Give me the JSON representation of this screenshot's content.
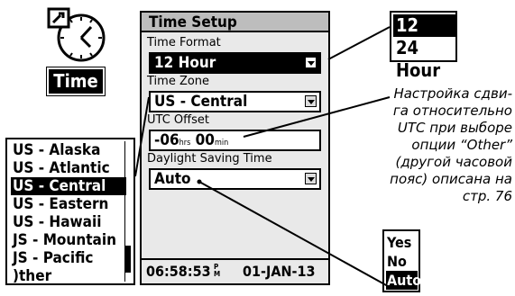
{
  "app": {
    "label": "Time",
    "icon": "clock-with-wrench-icon"
  },
  "screen": {
    "title": "Time Setup",
    "time_format": {
      "label": "Time Format",
      "value": "12 Hour"
    },
    "time_zone": {
      "label": "Time Zone",
      "value": "US - Central"
    },
    "utc_offset": {
      "label": "UTC Offset",
      "hours": "-06",
      "hours_unit": "hrs",
      "minutes": "00",
      "minutes_unit": "min"
    },
    "dst": {
      "label": "Daylight Saving Time",
      "value": "Auto"
    },
    "status": {
      "time": "06:58:53",
      "ampm": "P\nM",
      "date": "01-JAN-13"
    }
  },
  "hour_popup": {
    "items": [
      "12 Hour",
      "24 Hour"
    ],
    "selected_index": 0
  },
  "tz_popup": {
    "items": [
      "US - Alaska",
      "US - Atlantic",
      "US - Central",
      "US - Eastern",
      "US - Hawaii",
      "JS - Mountain",
      "JS - Pacific",
      ")ther"
    ],
    "selected_index": 2
  },
  "dst_popup": {
    "items": [
      "Yes",
      "No",
      "Auto"
    ],
    "selected_index": 2
  },
  "caption": "Настройка сдви-\nга относительно\nUTC при выборе\nопции “Other”\n(другой часовой\nпояс) описана на\nстр. 76",
  "colors": {
    "selection": "#000000",
    "screen_bg": "#e9e9e9",
    "title_bg": "#bdbdbd"
  }
}
